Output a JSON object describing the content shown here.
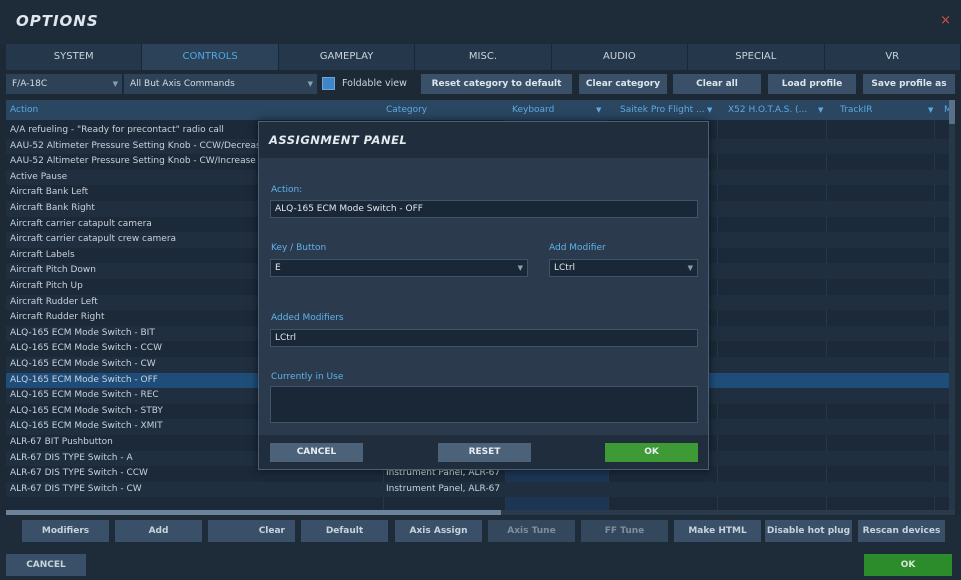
{
  "window": {
    "title": "OPTIONS",
    "close_glyph": "×"
  },
  "tabs": [
    "SYSTEM",
    "CONTROLS",
    "GAMEPLAY",
    "MISC.",
    "AUDIO",
    "SPECIAL",
    "VR"
  ],
  "active_tab": "CONTROLS",
  "filter": {
    "aircraft": "F/A-18C",
    "mode": "All But Axis Commands",
    "foldable_label": "Foldable view",
    "foldable_checked": true,
    "arrow": "▼"
  },
  "top_buttons": [
    "Reset category to default",
    "Clear category",
    "Clear all",
    "Load profile",
    "Save profile as"
  ],
  "grid": {
    "headers": {
      "action": "Action",
      "category": "Category",
      "keyboard": "Keyboard",
      "saitek": "Saitek Pro Flight ...",
      "x52": "X52 H.O.T.A.S. (...",
      "trackir": "TrackIR",
      "m": "M"
    },
    "rows": [
      {
        "action": "A/A refueling - \"Ready for precontact\" radio call",
        "category": ""
      },
      {
        "action": "AAU-52 Altimeter Pressure Setting Knob - CCW/Decrease",
        "category": ""
      },
      {
        "action": "AAU-52 Altimeter Pressure Setting Knob - CW/Increase",
        "category": ""
      },
      {
        "action": "Active Pause",
        "category": ""
      },
      {
        "action": "Aircraft Bank Left",
        "category": ""
      },
      {
        "action": "Aircraft Bank Right",
        "category": ""
      },
      {
        "action": "Aircraft carrier catapult camera",
        "category": ""
      },
      {
        "action": "Aircraft carrier catapult crew camera",
        "category": ""
      },
      {
        "action": "Aircraft Labels",
        "category": ""
      },
      {
        "action": "Aircraft Pitch Down",
        "category": ""
      },
      {
        "action": "Aircraft Pitch Up",
        "category": ""
      },
      {
        "action": "Aircraft Rudder Left",
        "category": ""
      },
      {
        "action": "Aircraft Rudder Right",
        "category": ""
      },
      {
        "action": "ALQ-165 ECM Mode Switch - BIT",
        "category": ""
      },
      {
        "action": "ALQ-165 ECM Mode Switch - CCW",
        "category": ""
      },
      {
        "action": "ALQ-165 ECM Mode Switch - CW",
        "category": ""
      },
      {
        "action": "ALQ-165 ECM Mode Switch - OFF",
        "category": ""
      },
      {
        "action": "ALQ-165 ECM Mode Switch - REC",
        "category": ""
      },
      {
        "action": "ALQ-165 ECM Mode Switch - STBY",
        "category": ""
      },
      {
        "action": "ALQ-165 ECM Mode Switch - XMIT",
        "category": ""
      },
      {
        "action": "ALR-67 BIT Pushbutton",
        "category": ""
      },
      {
        "action": "ALR-67 DIS TYPE Switch - A",
        "category": ""
      },
      {
        "action": "ALR-67 DIS TYPE Switch - CCW",
        "category": "Instrument Panel, ALR-67"
      },
      {
        "action": "ALR-67 DIS TYPE Switch - CW",
        "category": "Instrument Panel, ALR-67"
      }
    ],
    "selected_index": 16
  },
  "modal": {
    "title": "ASSIGNMENT PANEL",
    "action_label": "Action:",
    "action_value": "ALQ-165 ECM Mode Switch - OFF",
    "key_label": "Key / Button",
    "key_value": "E",
    "modifier_label": "Add Modifier",
    "modifier_value": "LCtrl",
    "added_label": "Added Modifiers",
    "added_value": "LCtrl",
    "in_use_label": "Currently in Use",
    "in_use_value": "",
    "cancel": "CANCEL",
    "reset": "RESET",
    "ok": "OK"
  },
  "bottom_buttons": [
    "Modifiers",
    "Add",
    "Clear",
    "Default",
    "Axis Assign",
    "Axis Tune",
    "FF Tune",
    "Make HTML",
    "Disable hot plug",
    "Rescan devices"
  ],
  "footer": {
    "cancel": "CANCEL",
    "ok": "OK"
  },
  "colors": {
    "accent": "#4fa9e6",
    "ok_green": "#2c8b2a",
    "selected_row": "#1f4d7a"
  }
}
